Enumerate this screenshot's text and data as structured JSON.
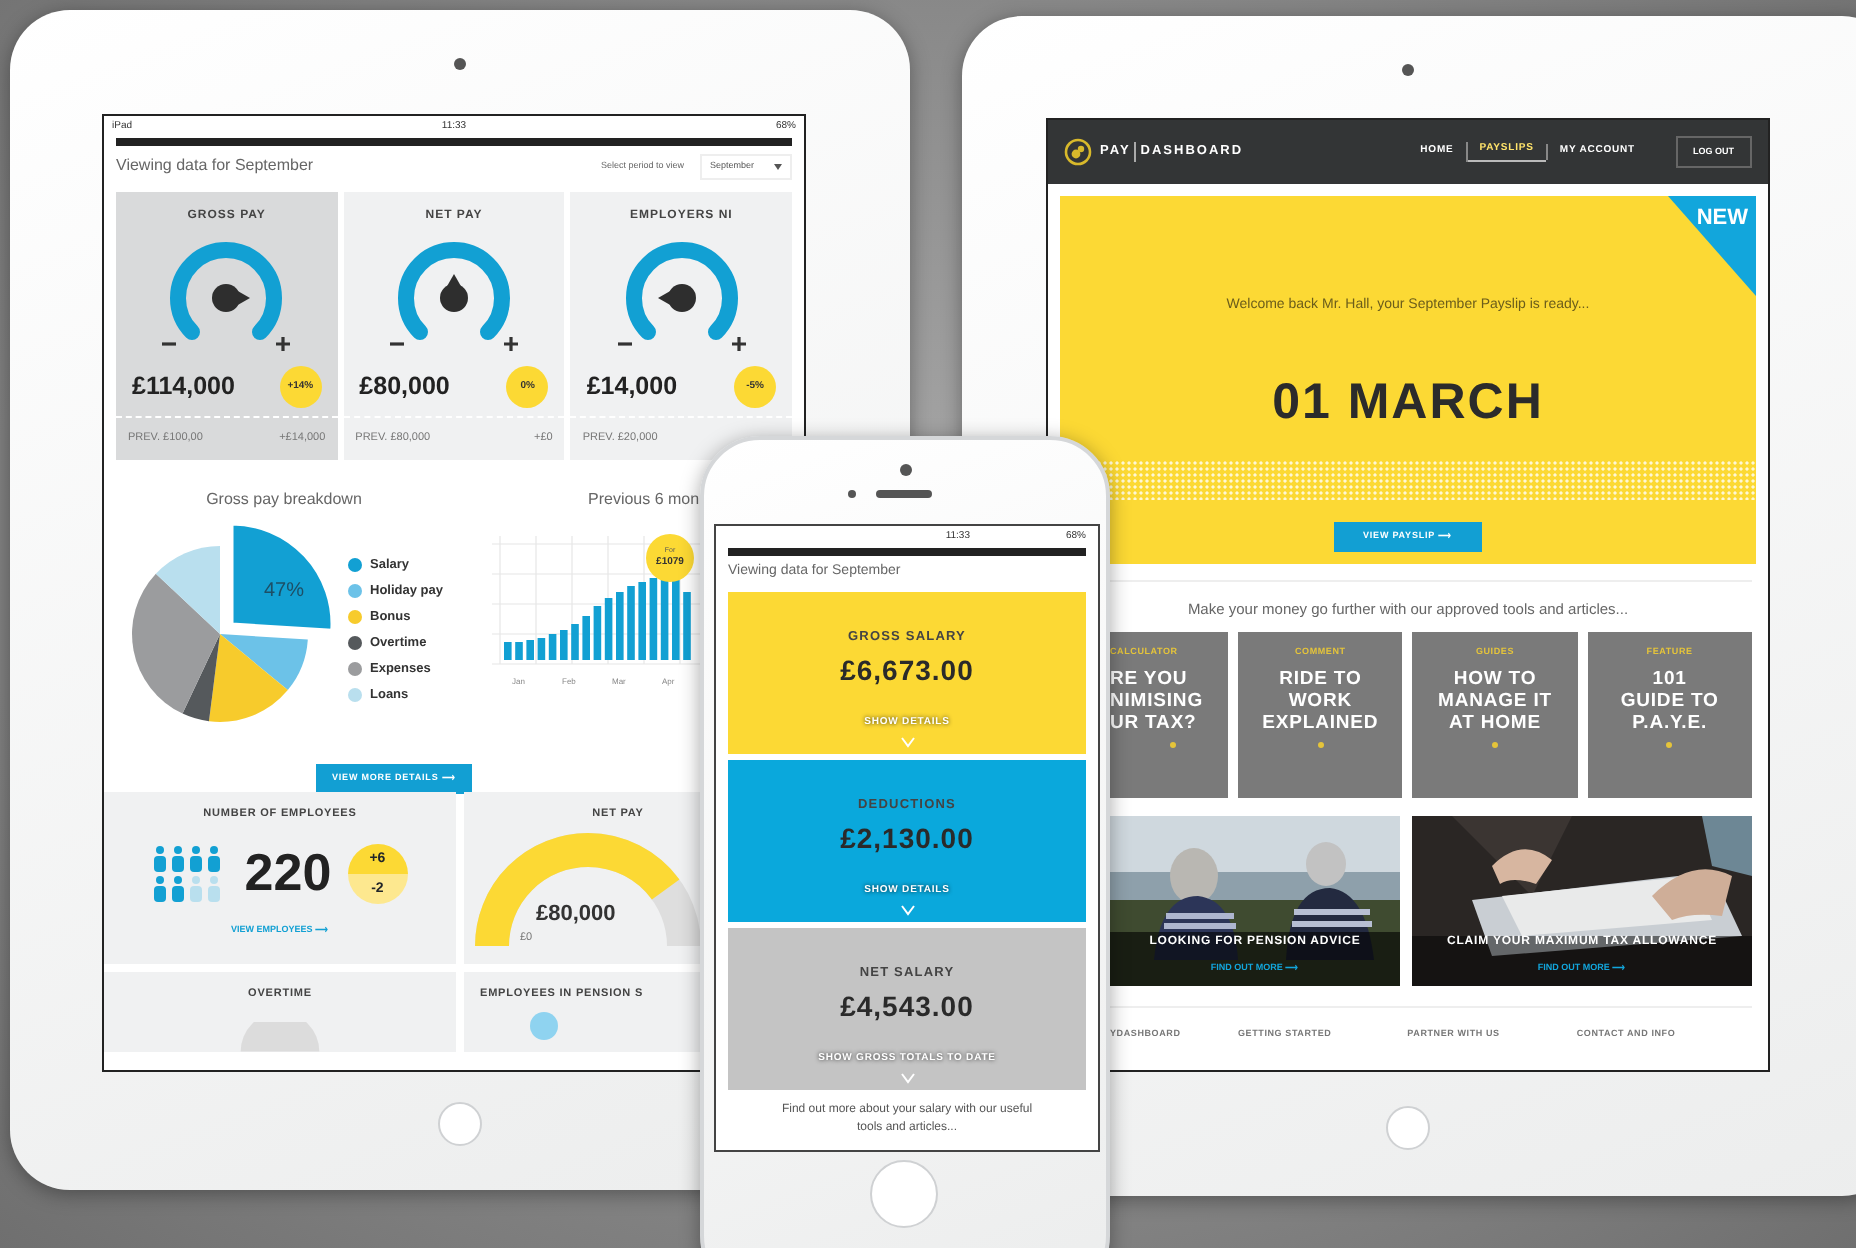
{
  "dashboard_tablet": {
    "status_bar": {
      "carrier": "iPad",
      "time": "11:33",
      "battery": "68%"
    },
    "heading": "Viewing data for September",
    "period_label": "Select period to view",
    "period_value": "September",
    "gauges": [
      {
        "title": "GROSS PAY",
        "amount": "£114,000",
        "change": "+14%",
        "previous": "PREV. £100,00",
        "difference": "+£14,000",
        "selected": true,
        "kind": "right"
      },
      {
        "title": "NET PAY",
        "amount": "£80,000",
        "change": "0%",
        "previous": "PREV. £80,000",
        "difference": "+£0",
        "selected": false,
        "kind": "up"
      },
      {
        "title": "EMPLOYERS NI",
        "amount": "£14,000",
        "change": "-5%",
        "previous": "PREV. £20,000",
        "selected": false,
        "kind": "left"
      }
    ],
    "breakdown": {
      "title": "Gross pay breakdown",
      "highlight": "47%",
      "legend": [
        {
          "label": "Salary",
          "color": "#12a0d3"
        },
        {
          "label": "Holiday pay",
          "color": "#6cc2e8"
        },
        {
          "label": "Bonus",
          "color": "#f7cb2c"
        },
        {
          "label": "Overtime",
          "color": "#55595c"
        },
        {
          "label": "Expenses",
          "color": "#9b9c9e"
        },
        {
          "label": "Loans",
          "color": "#b9dfee"
        }
      ]
    },
    "history": {
      "title": "Previous 6 mon",
      "bubble_label": "For",
      "bubble_amount": "£1079",
      "months": [
        "Jan",
        "Feb",
        "Mar",
        "Apr"
      ]
    },
    "details_button": "VIEW MORE DETAILS ⟶",
    "employees": {
      "title": "NUMBER OF EMPLOYEES",
      "count": "220",
      "added": "+6",
      "removed": "-2",
      "link": "VIEW EMPLOYEES ⟶",
      "people": [
        {
          "filled": true
        },
        {
          "filled": true
        },
        {
          "filled": true
        },
        {
          "filled": true
        },
        {
          "filled": true
        },
        {
          "filled": true
        },
        {
          "filled": false
        },
        {
          "filled": false
        }
      ]
    },
    "net_pay": {
      "title": "NET PAY",
      "amount": "£80,000",
      "minimum": "£0"
    },
    "overtime": {
      "title": "OVERTIME"
    },
    "pension": {
      "title": "EMPLOYEES IN PENSION S"
    }
  },
  "phone": {
    "status_bar": {
      "time": "11:33",
      "battery": "68%"
    },
    "heading": "Viewing data for September",
    "panels": [
      {
        "title": "GROSS SALARY",
        "amount": "£6,673.00",
        "link": "SHOW DETAILS",
        "color": "#fcd934"
      },
      {
        "title": "DEDUCTIONS",
        "amount": "£2,130.00",
        "link": "SHOW DETAILS",
        "color": "#0aa8dc"
      },
      {
        "title": "NET SALARY",
        "amount": "£4,543.00",
        "link": "SHOW GROSS TOTALS TO DATE",
        "color": "#c4c4c4"
      }
    ],
    "footer": "Find out more about your salary with our useful tools and articles..."
  },
  "site_tablet": {
    "brand_first": "PAY",
    "brand_second": "DASHBOARD",
    "nav": [
      {
        "label": "HOME",
        "selected": false
      },
      {
        "label": "PAYSLIPS",
        "selected": true
      },
      {
        "label": "MY ACCOUNT",
        "selected": false
      }
    ],
    "logout": "LOG OUT",
    "hero": {
      "ribbon": "NEW",
      "welcome": "Welcome back Mr. Hall, your September Payslip is ready...",
      "date": "01 MARCH",
      "button": "VIEW PAYSLIP ⟶"
    },
    "intro": "Make your money go further with our approved tools and articles...",
    "articles": [
      {
        "category": "CALCULATOR",
        "title": "RE YOU\nNIMISING\nUR TAX?"
      },
      {
        "category": "COMMENT",
        "title": "RIDE TO\nWORK\nEXPLAINED"
      },
      {
        "category": "GUIDES",
        "title": "HOW TO\nMANAGE IT\nAT HOME"
      },
      {
        "category": "FEATURE",
        "title": "101\nGUIDE TO\nP.A.Y.E."
      }
    ],
    "stories": [
      {
        "title": "LOOKING FOR PENSION ADVICE",
        "link": "FIND OUT MORE ⟶"
      },
      {
        "title": "CLAIM YOUR MAXIMUM TAX ALLOWANCE",
        "link": "FIND OUT MORE ⟶"
      }
    ],
    "footer_columns": [
      "YDASHBOARD",
      "GETTING STARTED",
      "PARTNER WITH US",
      "CONTACT AND INFO"
    ]
  }
}
